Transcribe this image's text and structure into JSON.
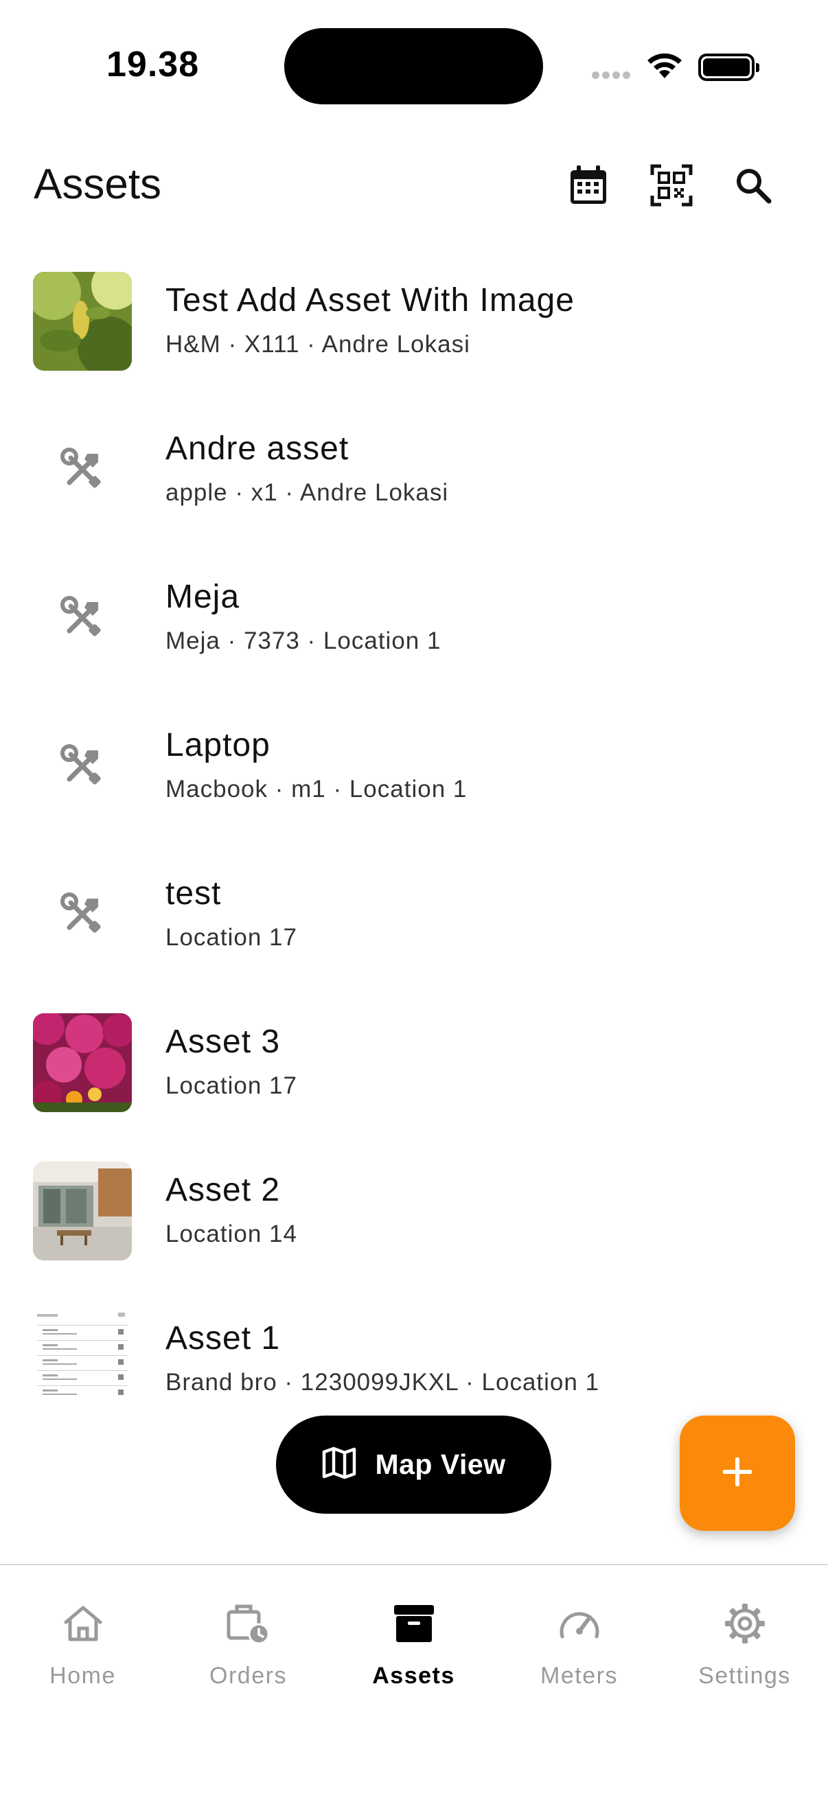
{
  "status_bar": {
    "time": "19.38"
  },
  "header": {
    "title": "Assets",
    "icons": [
      "calendar-icon",
      "qr-code-icon",
      "search-icon"
    ]
  },
  "assets": [
    {
      "name": "Test Add Asset With Image",
      "subtitle": "H&M · X111 · Andre Lokasi",
      "thumbnail": "photo-leaves"
    },
    {
      "name": "Andre asset",
      "subtitle": "apple · x1 · Andre Lokasi",
      "thumbnail": "tools-icon"
    },
    {
      "name": "Meja",
      "subtitle": "Meja · 7373 · Location 1",
      "thumbnail": "tools-icon"
    },
    {
      "name": "Laptop",
      "subtitle": "Macbook · m1 · Location 1",
      "thumbnail": "tools-icon"
    },
    {
      "name": "test",
      "subtitle": "Location 17",
      "thumbnail": "tools-icon"
    },
    {
      "name": "Asset 3",
      "subtitle": "Location 17",
      "thumbnail": "photo-flowers"
    },
    {
      "name": "Asset 2",
      "subtitle": "Location 14",
      "thumbnail": "photo-building"
    },
    {
      "name": "Asset 1",
      "subtitle": "Brand bro · 1230099JKXL · Location 1",
      "thumbnail": "photo-document"
    }
  ],
  "map_view": {
    "label": "Map View",
    "icon": "map-icon"
  },
  "fab": {
    "icon": "plus-icon",
    "color": "#fb8a0a"
  },
  "bottom_nav": {
    "items": [
      {
        "label": "Home",
        "icon": "home-icon",
        "active": false
      },
      {
        "label": "Orders",
        "icon": "orders-icon",
        "active": false
      },
      {
        "label": "Assets",
        "icon": "archive-icon",
        "active": true
      },
      {
        "label": "Meters",
        "icon": "gauge-icon",
        "active": false
      },
      {
        "label": "Settings",
        "icon": "gear-icon",
        "active": false
      }
    ]
  }
}
